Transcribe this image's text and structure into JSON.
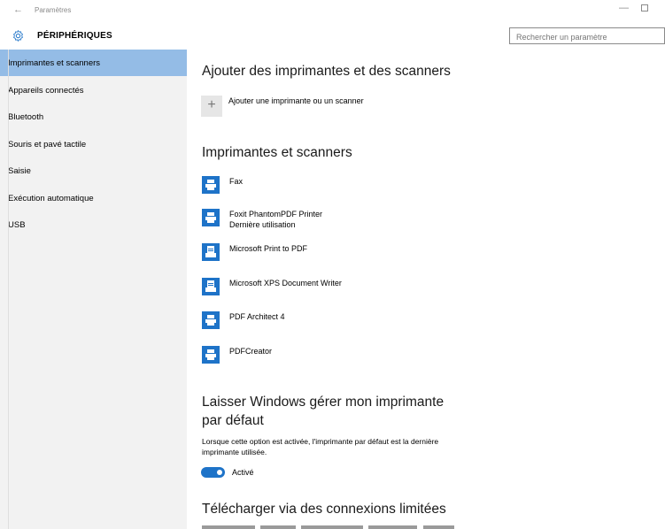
{
  "window": {
    "back_glyph": "←",
    "title": "Paramètres",
    "min_glyph": "—",
    "icons": [
      "back-arrow-icon",
      "minimize-icon",
      "maximize-icon"
    ]
  },
  "header": {
    "section_title": "PÉRIPHÉRIQUES",
    "section_icon": "gear-icon",
    "search_placeholder": "Rechercher un paramètre"
  },
  "sidebar": {
    "items": [
      {
        "label": "Imprimantes et scanners",
        "selected": true
      },
      {
        "label": "Appareils connectés"
      },
      {
        "label": "Bluetooth"
      },
      {
        "label": "Souris et pavé tactile"
      },
      {
        "label": "Saisie"
      },
      {
        "label": "Exécution automatique"
      },
      {
        "label": "USB"
      }
    ]
  },
  "main": {
    "add_section": {
      "heading": "Ajouter des imprimantes et des scanners",
      "add_glyph": "+",
      "add_label": "Ajouter une imprimante ou un scanner"
    },
    "printers_section": {
      "heading": "Imprimantes et scanners",
      "printers": [
        {
          "name": "Fax",
          "subtitle": "",
          "icon": "printer-icon"
        },
        {
          "name": "Foxit PhantomPDF Printer",
          "subtitle": "Dernière utilisation",
          "icon": "printer-icon"
        },
        {
          "name": "Microsoft Print to PDF",
          "subtitle": "",
          "icon": "document-printer-icon"
        },
        {
          "name": "Microsoft XPS Document Writer",
          "subtitle": "",
          "icon": "document-printer-icon"
        },
        {
          "name": "PDF Architect 4",
          "subtitle": "",
          "icon": "printer-icon"
        },
        {
          "name": "PDFCreator",
          "subtitle": "",
          "icon": "printer-icon"
        }
      ]
    },
    "default_section": {
      "heading": "Laisser Windows gérer mon imprimante par défaut",
      "description": "Lorsque cette option est activée, l'imprimante par défaut est la dernière imprimante utilisée.",
      "toggle_on": true,
      "toggle_label": "Activé"
    },
    "metered_section": {
      "heading": "Télécharger via des connexions limitées"
    }
  },
  "colors": {
    "accent": "#1e73c8",
    "selected_nav": "#94bce6",
    "sidebar_bg": "#f2f2f2"
  }
}
